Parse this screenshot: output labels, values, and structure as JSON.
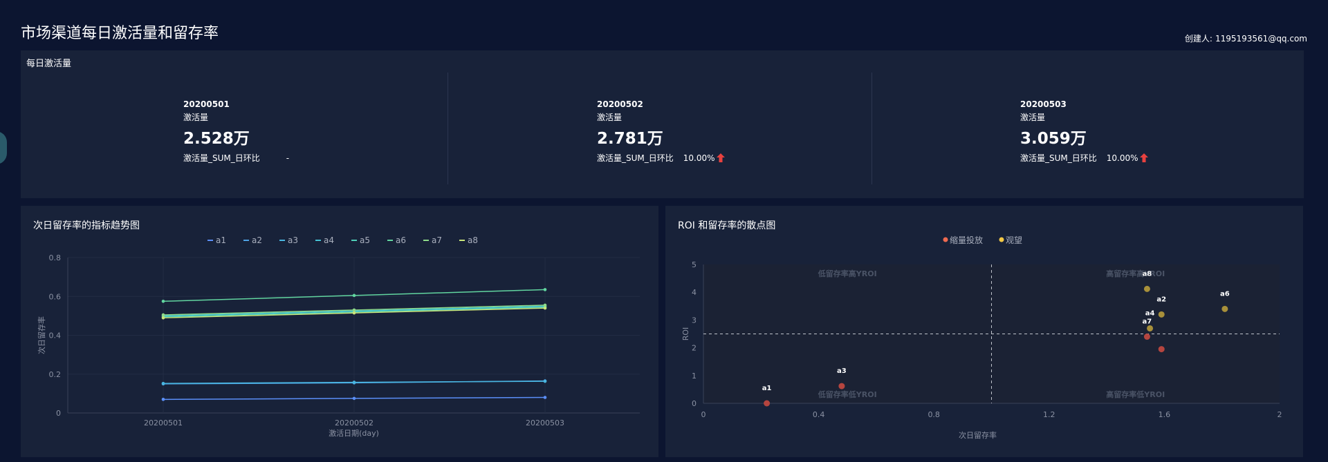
{
  "dashboard": {
    "title": "市场渠道每日激活量和留存率",
    "creator_label": "创建人:",
    "creator_email": "1195193561@qq.com"
  },
  "kpi_panel": {
    "title": "每日激活量",
    "cards": [
      {
        "date": "20200501",
        "metric": "激活量",
        "value": "2.528万",
        "ratio_label": "激活量_SUM_日环比",
        "ratio_value": "-",
        "trend": "none"
      },
      {
        "date": "20200502",
        "metric": "激活量",
        "value": "2.781万",
        "ratio_label": "激活量_SUM_日环比",
        "ratio_value": "10.00%",
        "trend": "up"
      },
      {
        "date": "20200503",
        "metric": "激活量",
        "value": "3.059万",
        "ratio_label": "激活量_SUM_日环比",
        "ratio_value": "10.00%",
        "trend": "up"
      }
    ],
    "up_color": "#e8413f"
  },
  "trend_panel": {
    "title": "次日留存率的指标趋势图"
  },
  "scatter_panel": {
    "title": "ROI 和留存率的散点图"
  },
  "chart_data": [
    {
      "type": "line",
      "title": "次日留存率的指标趋势图",
      "xlabel": "激活日期(day)",
      "ylabel": "次日留存率",
      "categories": [
        "20200501",
        "20200502",
        "20200503"
      ],
      "ylim": [
        0,
        0.8
      ],
      "yticks": [
        "0",
        "0.2",
        "0.4",
        "0.6",
        "0.8"
      ],
      "grid": true,
      "legend_position": "top",
      "series": [
        {
          "name": "a1",
          "color": "#5b8ff9",
          "values": [
            0.07,
            0.075,
            0.08
          ]
        },
        {
          "name": "a2",
          "color": "#4fa3e6",
          "values": [
            0.15,
            0.155,
            0.165
          ]
        },
        {
          "name": "a3",
          "color": "#49b6e0",
          "values": [
            0.152,
            0.158,
            0.163
          ]
        },
        {
          "name": "a4",
          "color": "#45c2d4",
          "values": [
            0.5,
            0.525,
            0.55
          ]
        },
        {
          "name": "a5",
          "color": "#4fd1b8",
          "values": [
            0.495,
            0.52,
            0.545
          ]
        },
        {
          "name": "a6",
          "color": "#62d6a0",
          "values": [
            0.575,
            0.605,
            0.635
          ]
        },
        {
          "name": "a7",
          "color": "#8fdc8a",
          "values": [
            0.505,
            0.53,
            0.555
          ]
        },
        {
          "name": "a8",
          "color": "#c9e57a",
          "values": [
            0.49,
            0.515,
            0.54
          ]
        }
      ]
    },
    {
      "type": "scatter",
      "title": "ROI 和留存率的散点图",
      "xlabel": "次日留存率",
      "ylabel": "ROI",
      "xlim": [
        0,
        2
      ],
      "ylim": [
        0,
        5
      ],
      "xticks": [
        "0",
        "0.4",
        "0.8",
        "1.2",
        "1.6",
        "2"
      ],
      "yticks": [
        "0",
        "1",
        "2",
        "3",
        "4",
        "5"
      ],
      "reference_x": 1.0,
      "reference_y": 2.5,
      "legend_position": "top",
      "quadrant_labels": {
        "top_left": "低留存率高YROI",
        "top_right": "高留存率高YROI",
        "bottom_left": "低留存率低YROI",
        "bottom_right": "高留存率低YROI"
      },
      "series": [
        {
          "name": "缩量投放",
          "color": "#ee6a50",
          "point_color": "#b5453f",
          "points": [
            {
              "label": "a1",
              "x": 0.22,
              "y": 0.0
            },
            {
              "label": "a3",
              "x": 0.48,
              "y": 0.62
            },
            {
              "label": "a7",
              "x": 1.54,
              "y": 2.4
            },
            {
              "label": "",
              "x": 1.59,
              "y": 1.95
            }
          ]
        },
        {
          "name": "观望",
          "color": "#f3c845",
          "point_color": "#a8903a",
          "points": [
            {
              "label": "a8",
              "x": 1.54,
              "y": 4.12
            },
            {
              "label": "a2",
              "x": 1.59,
              "y": 3.2
            },
            {
              "label": "a4",
              "x": 1.55,
              "y": 2.7
            },
            {
              "label": "a6",
              "x": 1.81,
              "y": 3.4
            }
          ]
        }
      ]
    }
  ]
}
